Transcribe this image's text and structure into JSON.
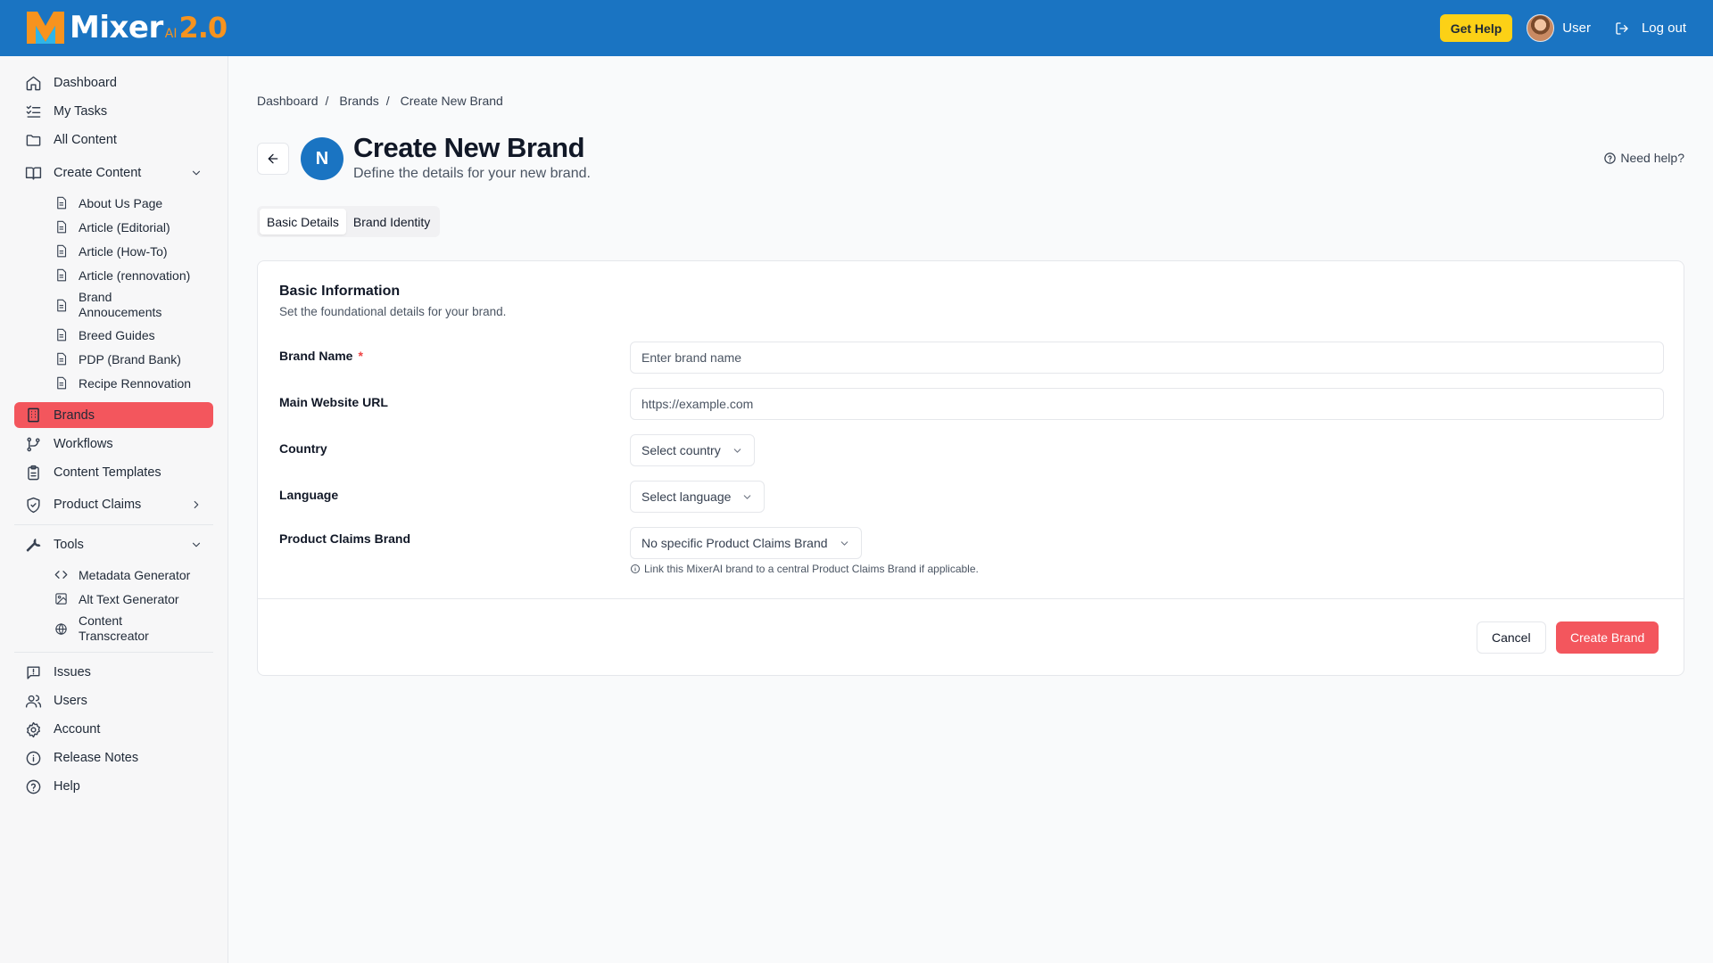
{
  "header": {
    "logo_text": "Mixer",
    "logo_ai": "AI",
    "logo_version": "2.0",
    "get_help_label": "Get Help",
    "user_label": "User",
    "logout_label": "Log out"
  },
  "sidebar": {
    "top_items": [
      {
        "label": "Dashboard",
        "icon": "home-icon"
      },
      {
        "label": "My Tasks",
        "icon": "tasks-icon"
      },
      {
        "label": "All Content",
        "icon": "folder-icon"
      }
    ],
    "create_content": {
      "label": "Create Content",
      "icon": "book-icon",
      "expanded": true,
      "items": [
        "About Us Page",
        "Article (Editorial)",
        "Article (How-To)",
        "Article (rennovation)",
        "Brand Annoucements",
        "Breed Guides",
        "PDP (Brand Bank)",
        "Recipe Rennovation"
      ]
    },
    "brands_label": "Brands",
    "workflows_label": "Workflows",
    "content_templates_label": "Content Templates",
    "product_claims_label": "Product Claims",
    "tools": {
      "label": "Tools",
      "items": [
        "Metadata Generator",
        "Alt Text Generator",
        "Content Transcreator"
      ]
    },
    "bottom_items": [
      {
        "label": "Issues",
        "icon": "issues-icon"
      },
      {
        "label": "Users",
        "icon": "users-icon"
      },
      {
        "label": "Account",
        "icon": "gear-icon"
      },
      {
        "label": "Release Notes",
        "icon": "info-icon"
      },
      {
        "label": "Help",
        "icon": "help-circle-icon"
      }
    ],
    "active_color": "#f3565d"
  },
  "breadcrumb": [
    "Dashboard",
    "Brands",
    "Create New Brand"
  ],
  "page": {
    "avatar_letter": "N",
    "title": "Create New Brand",
    "subtitle": "Define the details for your new brand.",
    "need_help": "Need help?"
  },
  "tabs": [
    "Basic Details",
    "Brand Identity"
  ],
  "form": {
    "section_title": "Basic Information",
    "section_desc": "Set the foundational details for your brand.",
    "brand_name_label": "Brand Name",
    "brand_name_required": "*",
    "brand_name_placeholder": "Enter brand name",
    "website_label": "Main Website URL",
    "website_placeholder": "https://example.com",
    "country_label": "Country",
    "country_value": "Select country",
    "language_label": "Language",
    "language_value": "Select language",
    "claims_label": "Product Claims Brand",
    "claims_value": "No specific Product Claims Brand",
    "claims_hint": "Link this MixerAI brand to a central Product Claims Brand if applicable.",
    "cancel_label": "Cancel",
    "create_label": "Create Brand"
  },
  "colors": {
    "header_bg": "#1a74c2",
    "accent_yellow": "#fcd116",
    "primary_red": "#f3565d"
  }
}
